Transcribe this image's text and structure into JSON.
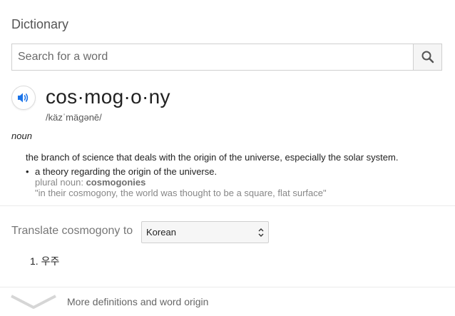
{
  "card": {
    "title": "Dictionary"
  },
  "search": {
    "placeholder": "Search for a word",
    "value": "",
    "button_icon": "search-icon"
  },
  "entry": {
    "speaker_icon": "speaker-icon",
    "headword": "cos·mog·o·ny",
    "phonetic": "/käzˈmägənē/",
    "part_of_speech": "noun",
    "definition": "the branch of science that deals with the origin of the universe, especially the solar system.",
    "senses": [
      {
        "text": "a theory regarding the origin of the universe.",
        "plural_label": "plural noun:",
        "plural_word": "cosmogonies",
        "example": "\"in their cosmogony, the world was thought to be a square, flat surface\""
      }
    ]
  },
  "translate": {
    "label": "Translate cosmogony to",
    "selected_language": "Korean",
    "results": [
      "1. 우주"
    ]
  },
  "more": {
    "label": "More definitions and word origin",
    "icon": "chevron-down-icon"
  },
  "colors": {
    "accent_blue": "#1a73e8",
    "muted_text": "#878787",
    "divider": "#ebebeb"
  }
}
